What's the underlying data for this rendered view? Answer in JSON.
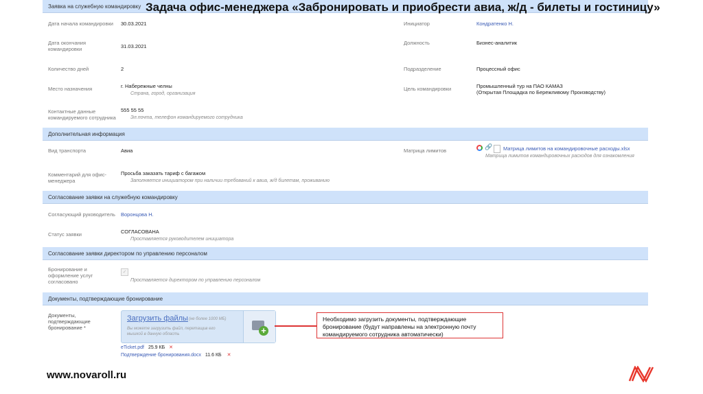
{
  "header": {
    "section": "Заявка на служебную командировку",
    "title": "Задача офис-менеджера «Забронировать и приобрести авиа, ж/д - билеты и гостиницу»"
  },
  "fields_left": [
    {
      "label": "Дата начала командировки",
      "value": "30.03.2021"
    },
    {
      "label": "Дата окончания командировки",
      "value": "31.03.2021"
    },
    {
      "label": "Количество дней",
      "value": "2"
    },
    {
      "label": "Место назначения",
      "value": "г. Набережные челны",
      "hint": "Страна, город, организация"
    },
    {
      "label": "Контактные данные командируемого сотрудника",
      "value": "555 55 55",
      "hint": "Эл.почта, телефон командируемого сотрудника"
    }
  ],
  "fields_right": [
    {
      "label": "Инициатор",
      "value": "Кондратенко Н."
    },
    {
      "label": "Должность",
      "value": "Бизнес-аналитик"
    },
    {
      "label": "Подразделение",
      "value": "Процесcный офис"
    },
    {
      "label": "Цель командировки",
      "value": "Промышленный тур на ПАО КАМАЗ",
      "value2": "(Открытая Площадка по Бережливому Производству)"
    }
  ],
  "additional": {
    "header": "Дополнительная информация",
    "transport_label": "Вид транспорта",
    "transport": "Авиа",
    "comment_label": "Комментарий для офис-менеджера",
    "comment": "Просьба заказать тариф с багажом",
    "comment_hint": "Заполняется инициатором при наличии требований к авиа, ж/д билетам, проживанию",
    "matrix_label": "Матрица лимитов",
    "matrix_file": "Матрица лимитов на командировочные расходы.xlsx",
    "matrix_hint": "Матрица лимитов командировочных расходов для ознакомления"
  },
  "approval": {
    "header": "Согласование заявки на служебную командировку",
    "manager_label": "Согласующий руководитель",
    "manager": "Воронцова Н.",
    "status_label": "Статус заявки",
    "status": "СОГЛАСОВАНА",
    "status_hint": "Проставляется руководителем инициатора"
  },
  "hr": {
    "header": "Согласование заявки директором по управлению персоналом",
    "label": "Бронирование и оформление услуг согласовано",
    "checked": true,
    "hint": "Проставляется директором по управлению персоналом"
  },
  "docs": {
    "header": "Документы, подтверждающие бронирование",
    "label": "Документы, подтверждающие бронирование *",
    "upload_link": "Загрузить файлы",
    "upload_limit": "(не более 1000 МБ)",
    "upload_hint": "Вы можете загрузить файл, перетащив его мышкой в данную область",
    "files": [
      {
        "name": "eTicket.pdf",
        "size": "25.9 КБ"
      },
      {
        "name": "Подтверждение бронирования.docx",
        "size": "11.6 КБ"
      }
    ]
  },
  "callout": "Необходимо загрузить документы, подтверждающие бронирование (будут направлены на электронную почту командируемого сотрудника автоматически)",
  "footer": {
    "site": "www.novaroll.ru",
    "logo": "N"
  }
}
